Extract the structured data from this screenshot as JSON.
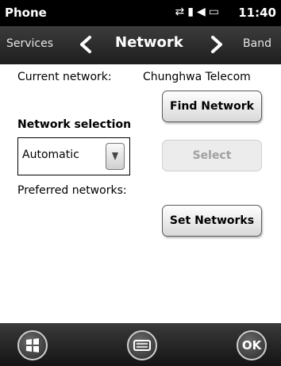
{
  "status_bar": {
    "app_title": "Phone",
    "clock": "11:40",
    "icons": [
      "data-sync-icon",
      "signal-icon",
      "volume-icon",
      "battery-icon"
    ]
  },
  "nav": {
    "prev_label": "Services",
    "current_label": "Network",
    "next_label": "Band"
  },
  "content": {
    "current_network_label": "Current network:",
    "current_network_value": "Chunghwa Telecom",
    "find_network_button": "Find Network",
    "network_selection_label": "Network selection",
    "network_selection_value": "Automatic",
    "select_button": "Select",
    "preferred_networks_label": "Preferred networks:",
    "set_networks_button": "Set Networks"
  },
  "bottom_bar": {
    "ok_label": "OK"
  }
}
